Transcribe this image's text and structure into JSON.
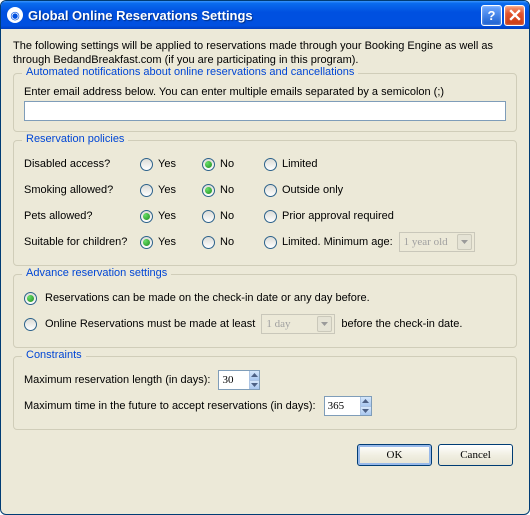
{
  "window": {
    "title": "Global Online Reservations Settings"
  },
  "intro": "The following settings will be applied to reservations made through your Booking Engine as well as through BedandBreakfast.com (if you are participating in this program).",
  "notifications": {
    "group_title": "Automated notifications about online reservations and cancellations",
    "label": "Enter email address below. You can enter multiple emails separated by a semicolon (;)",
    "value": ""
  },
  "policies": {
    "group_title": "Reservation policies",
    "disabled_label": "Disabled access?",
    "smoking_label": "Smoking allowed?",
    "pets_label": "Pets allowed?",
    "children_label": "Suitable for children?",
    "yes": "Yes",
    "no": "No",
    "limited": "Limited",
    "outside_only": "Outside only",
    "prior_approval": "Prior approval required",
    "limited_min_age": "Limited. Minimum age:",
    "min_age_value": "1 year old"
  },
  "advance": {
    "group_title": "Advance reservation settings",
    "opt_any": "Reservations can be made on the check-in date or any day before.",
    "opt_least_pre": "Online Reservations must be made at least",
    "opt_least_post": "before the check-in date.",
    "least_value": "1 day"
  },
  "constraints": {
    "group_title": "Constraints",
    "max_len_label": "Maximum reservation length (in days):",
    "max_len_value": "30",
    "max_future_label": "Maximum time in the future to accept reservations (in days):",
    "max_future_value": "365"
  },
  "buttons": {
    "ok": "OK",
    "cancel": "Cancel"
  }
}
